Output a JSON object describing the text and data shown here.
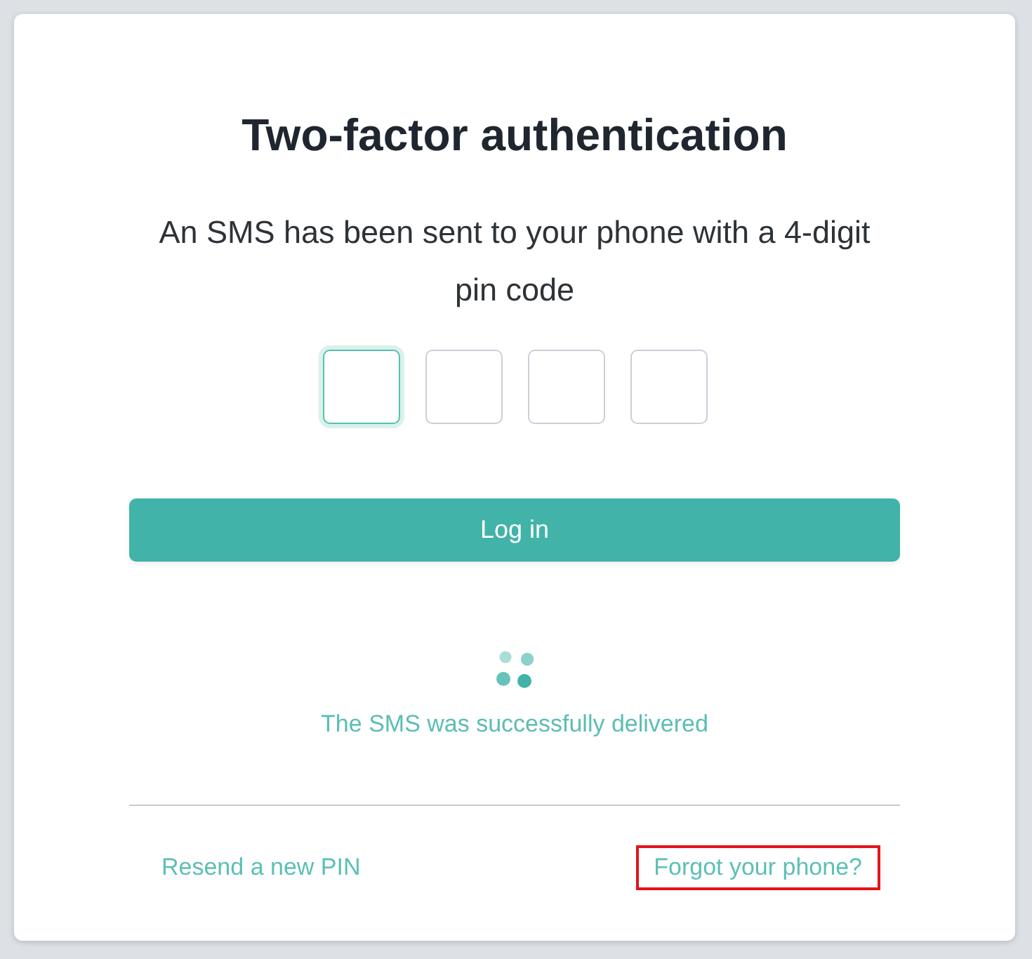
{
  "title": "Two-factor authentication",
  "message": "An SMS has been sent to your phone with a 4-digit pin code",
  "pin_fields": [
    {
      "focused": true
    },
    {
      "focused": false
    },
    {
      "focused": false
    },
    {
      "focused": false
    }
  ],
  "login_button": "Log in",
  "status": "The SMS was successfully delivered",
  "links": [
    {
      "label": "Resend a new PIN",
      "highlighted": false
    },
    {
      "label": "Forgot your phone?",
      "highlighted": true
    }
  ]
}
